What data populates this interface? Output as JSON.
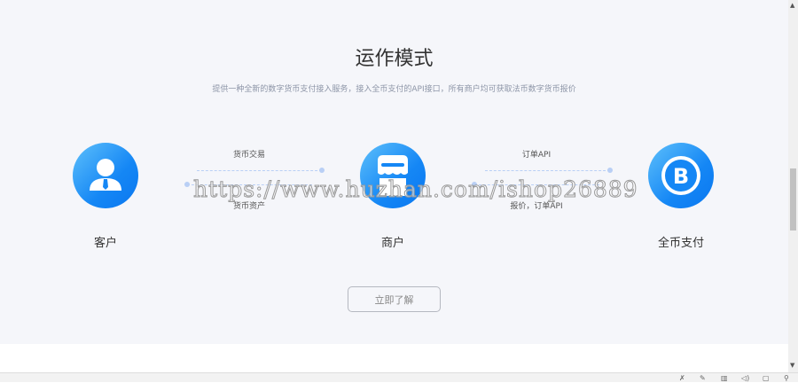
{
  "section": {
    "title": "运作模式",
    "subtitle": "提供一种全新的数字货币支付接入服务，接入全币支付的API接口，所有商户均可获取法币数字货币报价"
  },
  "nodes": [
    {
      "label": "客户",
      "icon": "user-icon"
    },
    {
      "label": "商户",
      "icon": "store-icon"
    },
    {
      "label": "全币支付",
      "icon": "b-logo-icon"
    }
  ],
  "flows": {
    "left_top": "货币交易",
    "left_bottom": "货币资产",
    "right_top": "订单API",
    "right_bottom": "报价，订单API"
  },
  "button": {
    "label": "立即了解"
  },
  "watermark": "https://www.huzhan.com/ishop26889",
  "colors": {
    "accent": "#1587f5",
    "background": "#f5f6fa"
  },
  "statusbar": {
    "icons": [
      "pin-icon",
      "edit-icon",
      "trash-icon",
      "speaker-icon",
      "window-icon",
      "search-icon"
    ]
  }
}
